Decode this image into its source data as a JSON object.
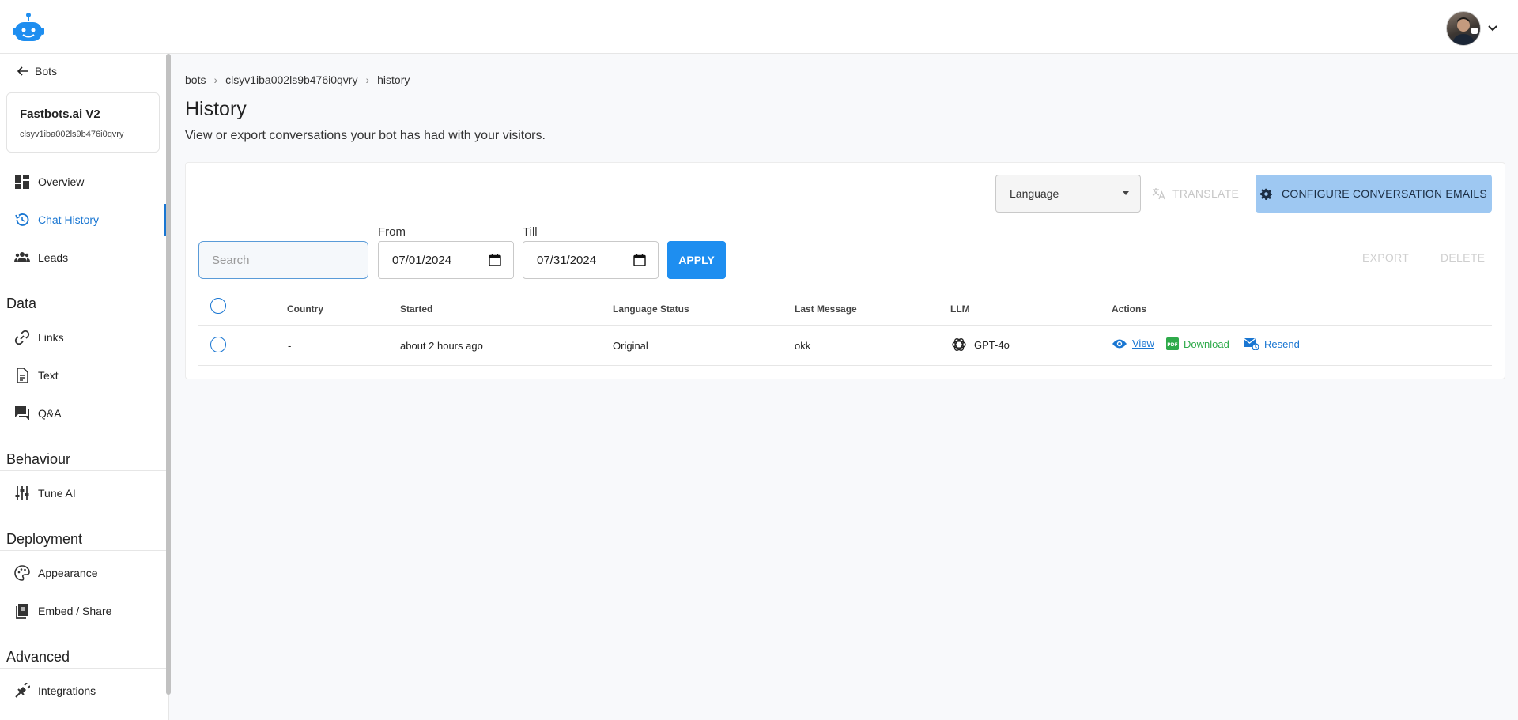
{
  "header": {
    "logo_name": "bot-logo-icon",
    "avatar_name": "user-avatar"
  },
  "sidebar": {
    "back_label": "Bots",
    "bot": {
      "name": "Fastbots.ai V2",
      "id": "clsyv1iba002ls9b476i0qvry"
    },
    "items_top": [
      {
        "label": "Overview",
        "icon": "dashboard-icon"
      },
      {
        "label": "Chat History",
        "icon": "history-icon",
        "active": true
      },
      {
        "label": "Leads",
        "icon": "people-icon"
      }
    ],
    "sections": [
      {
        "title": "Data",
        "items": [
          {
            "label": "Links",
            "icon": "link-icon"
          },
          {
            "label": "Text",
            "icon": "document-icon"
          },
          {
            "label": "Q&A",
            "icon": "chat-icon"
          }
        ]
      },
      {
        "title": "Behaviour",
        "items": [
          {
            "label": "Tune AI",
            "icon": "tune-icon"
          }
        ]
      },
      {
        "title": "Deployment",
        "items": [
          {
            "label": "Appearance",
            "icon": "palette-icon"
          },
          {
            "label": "Embed / Share",
            "icon": "embed-icon"
          }
        ]
      },
      {
        "title": "Advanced",
        "items": [
          {
            "label": "Integrations",
            "icon": "plug-icon"
          }
        ]
      }
    ]
  },
  "breadcrumb": [
    "bots",
    "clsyv1iba002ls9b476i0qvry",
    "history"
  ],
  "page": {
    "title": "History",
    "subtitle": "View or export conversations your bot has had with your visitors."
  },
  "toolbar": {
    "language_label": "Language",
    "translate_label": "TRANSLATE",
    "configure_label": "CONFIGURE CONVERSATION EMAILS",
    "search_placeholder": "Search",
    "from_label": "From",
    "from_value": "07/01/2024",
    "till_label": "Till",
    "till_value": "07/31/2024",
    "apply_label": "APPLY",
    "export_label": "EXPORT",
    "delete_label": "DELETE"
  },
  "table": {
    "columns": [
      "Country",
      "Started",
      "Language Status",
      "Last Message",
      "LLM",
      "Actions"
    ],
    "rows": [
      {
        "country": "-",
        "started": "about 2 hours ago",
        "language_status": "Original",
        "last_message": "okk",
        "llm": "GPT-4o",
        "actions": {
          "view": "View",
          "download": "Download",
          "resend": "Resend"
        }
      }
    ]
  },
  "colors": {
    "primary": "#1976d2",
    "apply": "#1e8ef0",
    "configure": "#9ec8f2",
    "download": "#2eaa4a"
  }
}
